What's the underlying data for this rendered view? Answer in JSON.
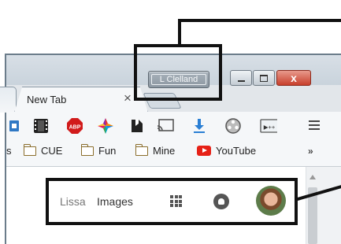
{
  "window": {
    "user_chip_label": "L Clelland",
    "close_glyph": "x"
  },
  "tabs": {
    "active_title": "New Tab",
    "close_glyph": "×"
  },
  "toolbar": {
    "extension_icons": [
      "screen-capture-icon",
      "film-icon",
      "adblock-icon",
      "pinwheel-icon",
      "pocket-icon",
      "cast-icon",
      "download-icon",
      "reel-icon",
      "code-icon"
    ],
    "adblock_label": "ABP",
    "code_label": "▶++"
  },
  "bookmarks": {
    "stub_label": "s",
    "items": [
      {
        "label": "CUE",
        "icon": "folder-icon"
      },
      {
        "label": "Fun",
        "icon": "folder-icon"
      },
      {
        "label": "Mine",
        "icon": "folder-icon"
      },
      {
        "label": "YouTube",
        "icon": "youtube-icon"
      }
    ],
    "overflow": "»"
  },
  "google_bar": {
    "user_link": "Lissa",
    "images_link": "Images"
  },
  "colors": {
    "youtube_red": "#e62117",
    "download_blue": "#2a7fd4",
    "adblock_red": "#d11b1b"
  }
}
